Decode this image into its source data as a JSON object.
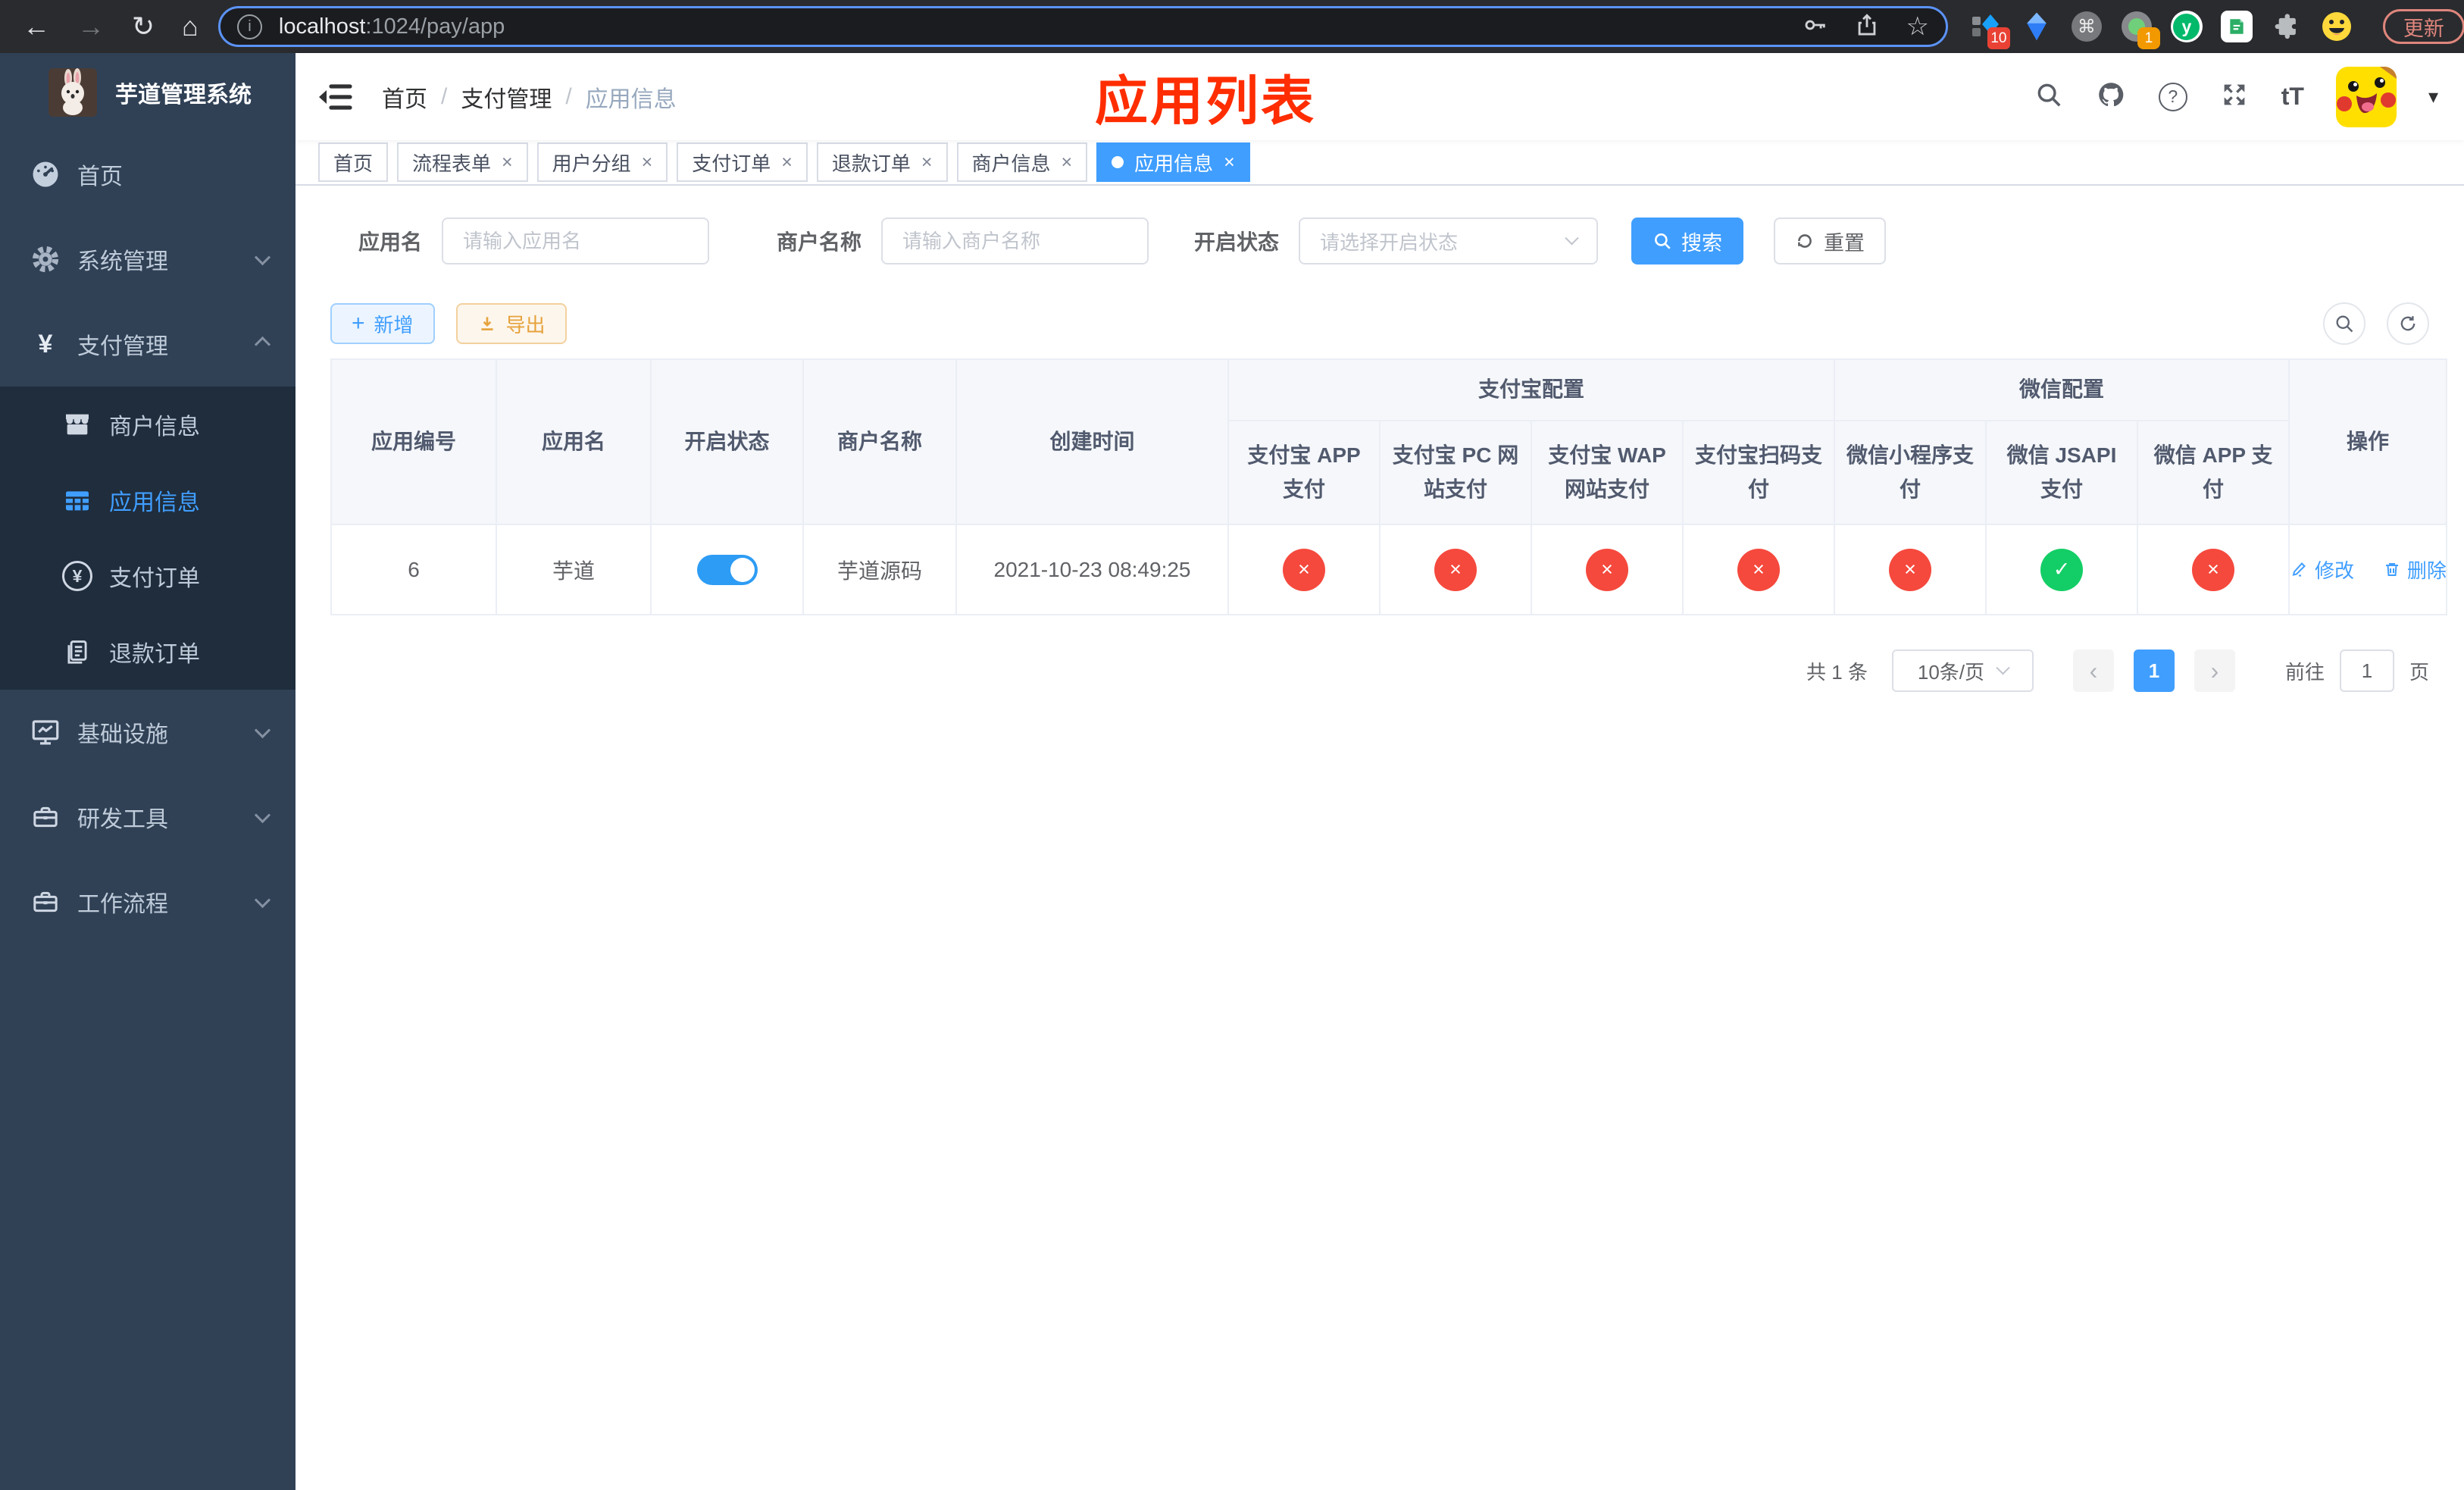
{
  "browser": {
    "url_host": "localhost",
    "url_path": ":1024/pay/app",
    "update_label": "更新",
    "ext_badge_dict": "10",
    "ext_badge_profile": "1"
  },
  "icons": {
    "back": "←",
    "forward": "→",
    "reload": "↻",
    "home": "⌂",
    "info": "i",
    "star": "☆",
    "cmd": "⌘",
    "kebab": "⋮",
    "question": "?",
    "font_size": "tT",
    "caret": "▾",
    "close": "×",
    "check": "✓",
    "cross": "×",
    "prev": "‹",
    "next": "›",
    "plus": "+",
    "yen": "¥",
    "ext_y": "y",
    "crumb_sep": "/"
  },
  "sidebar": {
    "logo_title": "芋道管理系统",
    "items": [
      {
        "label": "首页"
      },
      {
        "label": "系统管理"
      },
      {
        "label": "支付管理"
      },
      {
        "label": "基础设施"
      },
      {
        "label": "研发工具"
      },
      {
        "label": "工作流程"
      }
    ],
    "submenu": [
      {
        "label": "商户信息"
      },
      {
        "label": "应用信息"
      },
      {
        "label": "支付订单"
      },
      {
        "label": "退款订单"
      }
    ]
  },
  "navbar": {
    "breadcrumb": [
      "首页",
      "支付管理",
      "应用信息"
    ]
  },
  "overlay": {
    "title": "应用列表"
  },
  "tags": [
    {
      "label": "首页"
    },
    {
      "label": "流程表单"
    },
    {
      "label": "用户分组"
    },
    {
      "label": "支付订单"
    },
    {
      "label": "退款订单"
    },
    {
      "label": "商户信息"
    },
    {
      "label": "应用信息"
    }
  ],
  "filters": {
    "app_name_label": "应用名",
    "app_name_placeholder": "请输入应用名",
    "merchant_label": "商户名称",
    "merchant_placeholder": "请输入商户名称",
    "status_label": "开启状态",
    "status_placeholder": "请选择开启状态",
    "search_label": "搜索",
    "reset_label": "重置"
  },
  "toolbar": {
    "add_label": "新增",
    "export_label": "导出"
  },
  "table": {
    "headers": {
      "app_id": "应用编号",
      "app_name": "应用名",
      "status": "开启状态",
      "merchant": "商户名称",
      "created": "创建时间",
      "alipay_group": "支付宝配置",
      "wechat_group": "微信配置",
      "ops": "操作",
      "alipay": [
        "支付宝 APP 支付",
        "支付宝 PC 网站支付",
        "支付宝 WAP 网站支付",
        "支付宝扫码支付"
      ],
      "wechat": [
        "微信小程序支付",
        "微信 JSAPI 支付",
        "微信 APP 支付"
      ]
    },
    "rows": [
      {
        "id": "6",
        "name": "芋道",
        "enabled": true,
        "merchant": "芋道源码",
        "created": "2021-10-23 08:49:25",
        "channels": [
          false,
          false,
          false,
          false,
          false,
          true,
          false
        ],
        "edit_label": "修改",
        "delete_label": "删除"
      }
    ]
  },
  "pagination": {
    "total": "共 1 条",
    "page_size": "10条/页",
    "current_page": "1",
    "jump_prefix": "前往",
    "jump_value": "1",
    "jump_suffix": "页"
  },
  "colors": {
    "accent": "#409eff",
    "success": "#13ce66",
    "danger": "#f5493d",
    "warning": "#e6a23c",
    "sidebar_bg": "#304156",
    "submenu_bg": "#1f2d3d",
    "overlay_title_red": "#ff2d00"
  }
}
